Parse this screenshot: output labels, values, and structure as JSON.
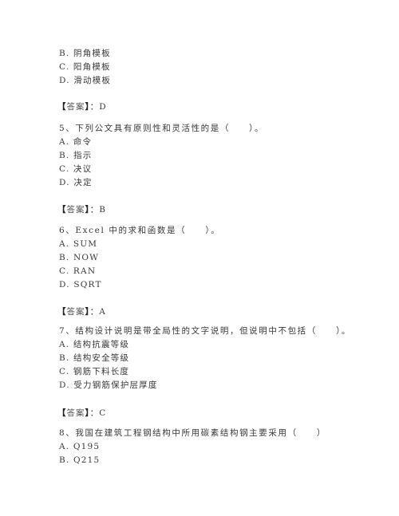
{
  "document": {
    "blocks": [
      {
        "type": "options-continued",
        "options": [
          "B. 阴角模板",
          "C. 阳角模板",
          "D. 滑动模板"
        ],
        "answer": "D"
      },
      {
        "type": "question",
        "number": "5",
        "question": "5、下列公文具有原则性和灵活性的是（　　）。",
        "options": [
          "A. 命令",
          "B. 指示",
          "C. 决议",
          "D. 决定"
        ],
        "answer": "B"
      },
      {
        "type": "question",
        "number": "6",
        "question": "6、Excel 中的求和函数是（　　）。",
        "options": [
          "A. SUM",
          "B. NOW",
          "C. RAN",
          "D. SQRT"
        ],
        "answer": "A"
      },
      {
        "type": "question",
        "number": "7",
        "question": "7、结构设计说明是带全局性的文字说明，但说明中不包括（　　）。",
        "options": [
          "A. 结构抗震等级",
          "B. 结构安全等级",
          "C. 钢筋下料长度",
          "D. 受力钢筋保护层厚度"
        ],
        "answer": "C"
      },
      {
        "type": "question",
        "number": "8",
        "question": "8、我国在建筑工程钢结构中所用碳素结构钢主要采用（　　）",
        "options": [
          "A. Q195",
          "B. Q215"
        ]
      }
    ],
    "answer_open": "【",
    "answer_label": "答案",
    "answer_close": "】",
    "answer_sep": "："
  }
}
